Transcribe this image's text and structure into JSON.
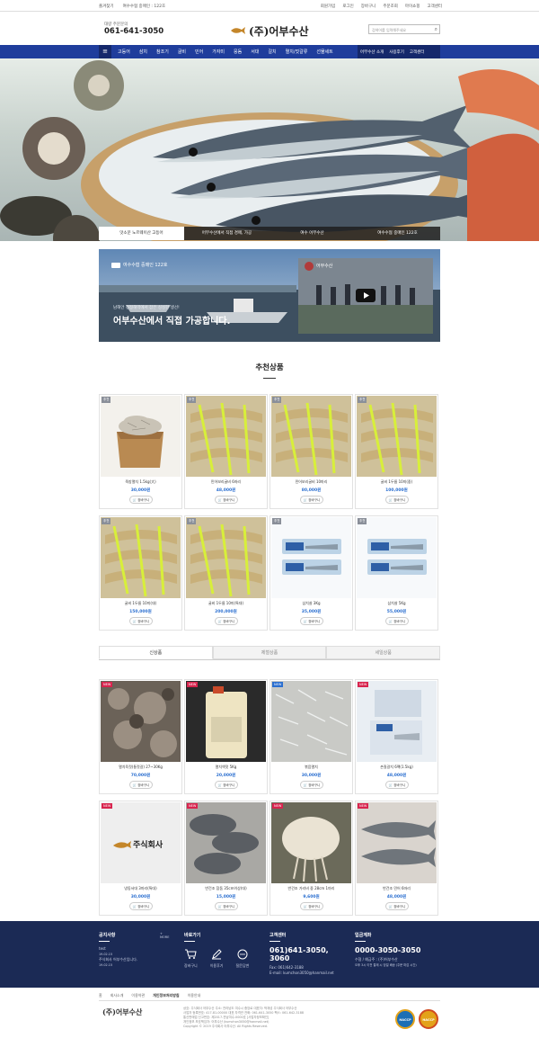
{
  "topbar": {
    "left": [
      "즐겨찾기",
      "여수수협 중매인 : 122호"
    ],
    "right": [
      "회원가입",
      "로그인",
      "장바구니",
      "주문조회",
      "마이쇼핑",
      "고객센터"
    ]
  },
  "header": {
    "phone_label": "대량 주문문의",
    "phone": "061-641-3050",
    "logo_text": "(주)어부수산",
    "search_placeholder": "검색어를 입력해주세요"
  },
  "nav": {
    "items": [
      "고등어",
      "삼치",
      "참조기",
      "굴비",
      "민어",
      "가자미",
      "뭉돔",
      "서대",
      "갈치",
      "멸치/젓갈류",
      "선물세트"
    ],
    "right": [
      "어부수산 소개",
      "사용후기",
      "고객센터"
    ]
  },
  "hero_tabs": [
    "맛소문 노르웨이산 고등어",
    "어부수산에서 직접 경매, 가공",
    "여수 어부수산",
    "여수수협 중매인 122호"
  ],
  "banner": {
    "tag": "여수수협 중매인 122호",
    "line1": "남해안 청정해역에서 잡은 싱싱한 생선!",
    "line2": "어부수산에서 직접 가공합니다.",
    "video_title": "어부수산"
  },
  "recommend": {
    "title": "추천상품",
    "products": [
      {
        "badge": "추천",
        "name": "죽방멸치 1.5kg(大)",
        "price": "30,000원"
      },
      {
        "badge": "추천",
        "name": "민어보리굴비 6마리",
        "price": "48,000원"
      },
      {
        "badge": "추천",
        "name": "민어보리굴비 10마리",
        "price": "80,000원"
      },
      {
        "badge": "추천",
        "name": "굴비 1두름 10미(중)",
        "price": "100,000원"
      },
      {
        "badge": "추천",
        "name": "굴비 1두름 10미(대)",
        "price": "150,000원"
      },
      {
        "badge": "추천",
        "name": "굴비 1두름 10미(특대)",
        "price": "200,000원"
      },
      {
        "badge": "추천",
        "name": "삼치살 3Kg",
        "price": "35,000원"
      },
      {
        "badge": "추천",
        "name": "삼치살 5Kg",
        "price": "55,000원"
      }
    ]
  },
  "tabs2": [
    "신상품",
    "제철상품",
    "세일상품"
  ],
  "new_products": [
    {
      "badge": "NEW",
      "name": "멸치육젓(통젓갈) 27~30Kg",
      "price": "70,000원"
    },
    {
      "badge": "NEW",
      "name": "멸치액젓 5Kg",
      "price": "20,000원"
    },
    {
      "badge": "NEW",
      "name": "볶음멸치",
      "price": "30,000원"
    },
    {
      "badge": "NEW",
      "name": "손질갈치 6팩(1.5kg)",
      "price": "48,000원"
    },
    {
      "badge": "NEW",
      "name": "냉동서대 3마리(특대)",
      "price": "30,000원"
    },
    {
      "badge": "NEW",
      "name": "반건조 참돔 35cm이상(대)",
      "price": "15,000원"
    },
    {
      "badge": "NEW",
      "name": "반건조 가리비 중 28cm 1마리",
      "price": "9,600원"
    },
    {
      "badge": "NEW",
      "name": "반건조 민어 6마리",
      "price": "48,000원"
    }
  ],
  "cart_label": "장바구니",
  "footer": {
    "notice_title": "공지사항",
    "notice_more": "+ MORE",
    "notice_items": [
      "test",
      "주식회사 어부수산입니다."
    ],
    "notice_dates": [
      "19.02.15",
      "19.02.15"
    ],
    "quick_title": "바로가기",
    "quick_items": [
      "장바구니",
      "이용후기",
      "질문답변"
    ],
    "cs_title": "고객센터",
    "cs_phone": "061)641-3050, 3060",
    "cs_fax": "Fax: 061)642-3188",
    "cs_email": "E-mail: kumchon3050@hanmail.net",
    "bank_title": "입금계좌",
    "bank_account": "0000-3050-3050",
    "bank_holder": "수협 / 예금주 : (주)어부수산",
    "bank_note": "오후 3시 이전 결제 시 당일 배송 (주문 마감 시간)",
    "links": [
      "홈",
      "회사소개",
      "이용약관",
      "개인정보처리방침",
      "이용안내"
    ],
    "logo": "(주)어부수산",
    "info": [
      "상호: 주식회사 어부수산 주소: 전라남도 여수시 중앙로 대표자: 박재성 주식회사 어부수산",
      "사업자 등록번호: 4​17-81-00000 대표 자격관 전화: 061-641-3050 팩스: 061-642-3188",
      "통신판매업 신고번호: 제2017-전남여수-0000호 [사업자정보확인]",
      "개인정보 보호책임자: 어부수산 (kumchon3050@hanmail.net)",
      "Copyright © 2019 주식회사 어부수산. All Rights Reserved."
    ],
    "cert1": "HACCP",
    "cert2": "HACCP"
  }
}
